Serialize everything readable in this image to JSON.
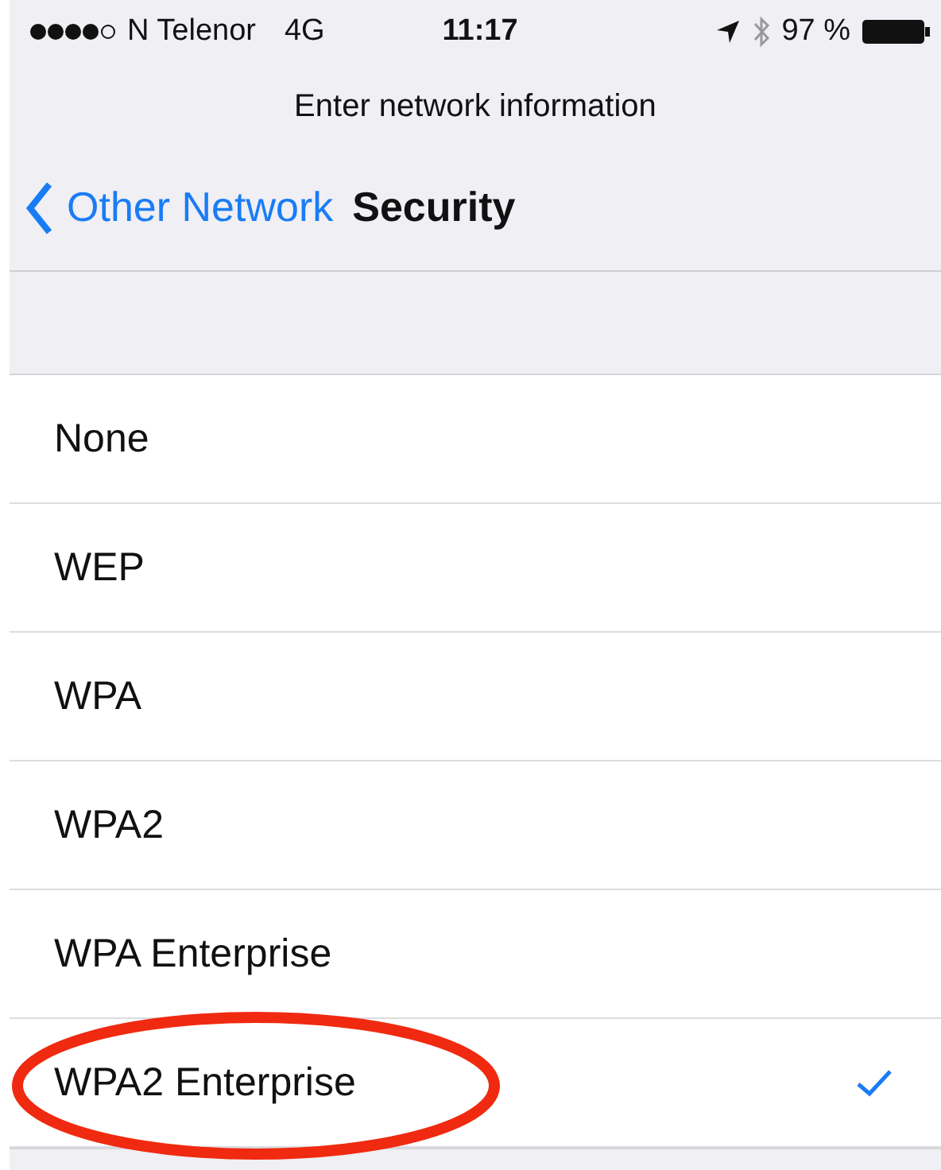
{
  "status_bar": {
    "carrier": "N Telenor",
    "network": "4G",
    "time": "11:17",
    "battery": "97 %"
  },
  "prompt": "Enter network information",
  "nav": {
    "back": "Other Network",
    "title": "Security"
  },
  "options": [
    {
      "label": "None",
      "selected": false,
      "circled": false
    },
    {
      "label": "WEP",
      "selected": false,
      "circled": false
    },
    {
      "label": "WPA",
      "selected": false,
      "circled": false
    },
    {
      "label": "WPA2",
      "selected": false,
      "circled": false
    },
    {
      "label": "WPA Enterprise",
      "selected": false,
      "circled": false
    },
    {
      "label": "WPA2 Enterprise",
      "selected": true,
      "circled": true
    }
  ]
}
